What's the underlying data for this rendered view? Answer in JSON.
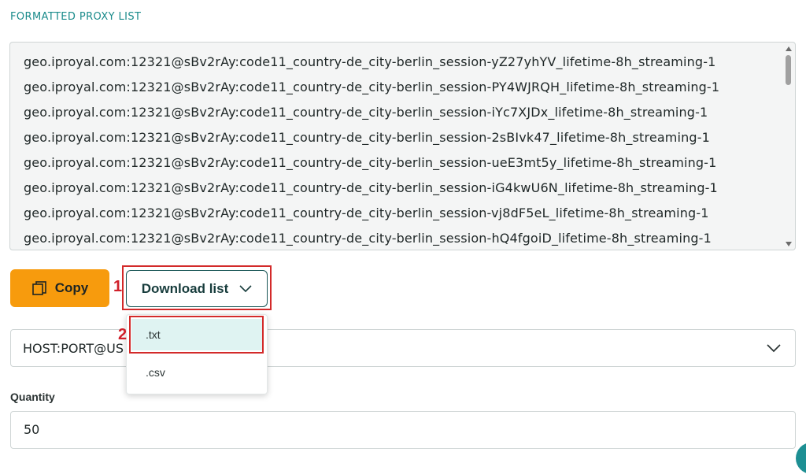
{
  "section": {
    "title": "FORMATTED PROXY LIST"
  },
  "proxies": [
    "geo.iproyal.com:12321@sBv2rAy:code11_country-de_city-berlin_session-yZ27yhYV_lifetime-8h_streaming-1",
    "geo.iproyal.com:12321@sBv2rAy:code11_country-de_city-berlin_session-PY4WJRQH_lifetime-8h_streaming-1",
    "geo.iproyal.com:12321@sBv2rAy:code11_country-de_city-berlin_session-iYc7XJDx_lifetime-8h_streaming-1",
    "geo.iproyal.com:12321@sBv2rAy:code11_country-de_city-berlin_session-2sBIvk47_lifetime-8h_streaming-1",
    "geo.iproyal.com:12321@sBv2rAy:code11_country-de_city-berlin_session-ueE3mt5y_lifetime-8h_streaming-1",
    "geo.iproyal.com:12321@sBv2rAy:code11_country-de_city-berlin_session-iG4kwU6N_lifetime-8h_streaming-1",
    "geo.iproyal.com:12321@sBv2rAy:code11_country-de_city-berlin_session-vj8dF5eL_lifetime-8h_streaming-1",
    "geo.iproyal.com:12321@sBv2rAy:code11_country-de_city-berlin_session-hQ4fgoiD_lifetime-8h_streaming-1"
  ],
  "actions": {
    "copy_label": "Copy",
    "download_label": "Download list"
  },
  "annotations": {
    "step1": "1",
    "step2": "2"
  },
  "download_menu": {
    "items": [
      ".txt",
      ".csv"
    ],
    "selected": ".txt"
  },
  "format": {
    "value": "HOST:PORT@US"
  },
  "quantity": {
    "label": "Quantity",
    "value": "50"
  },
  "colors": {
    "accent": "#f79b0d",
    "teal": "#1a8b8b",
    "highlight": "#d32a2a"
  }
}
